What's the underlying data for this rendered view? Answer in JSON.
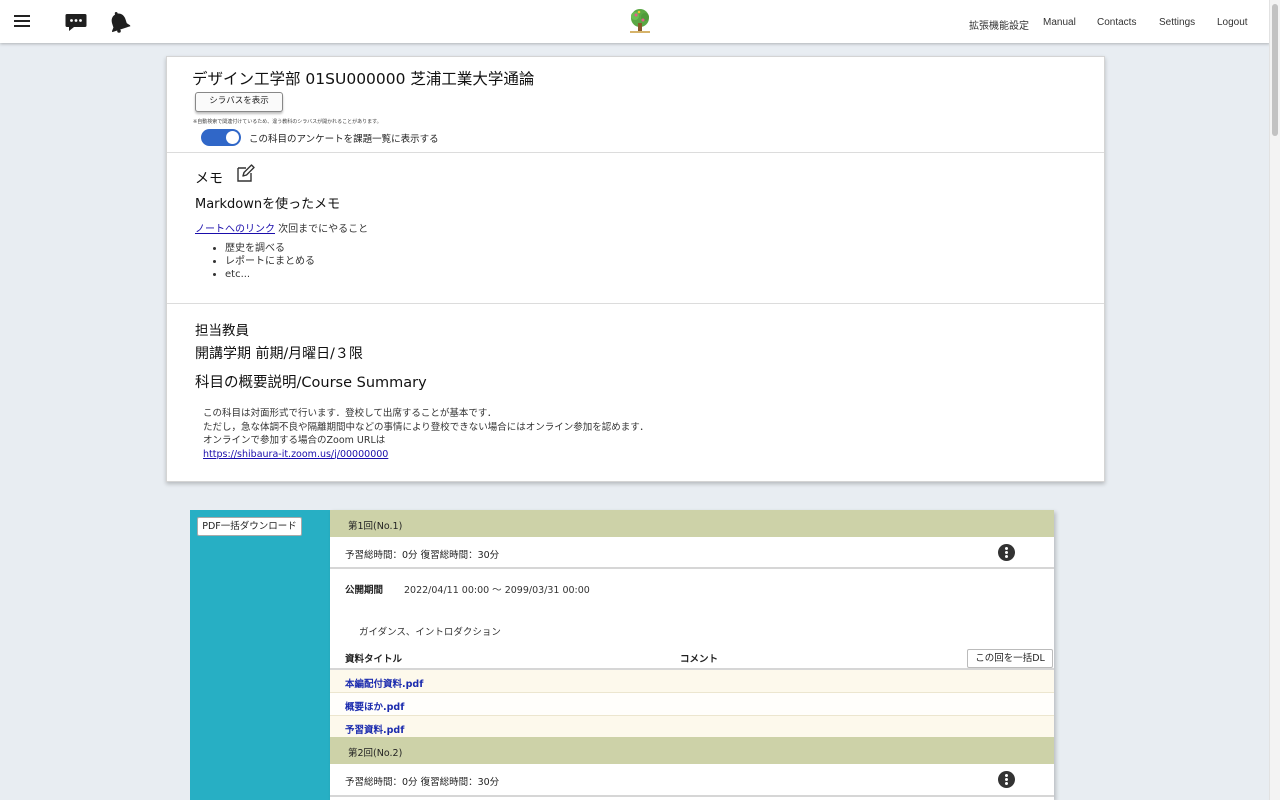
{
  "nav": {
    "links": [
      "拡張機能設定",
      "Manual",
      "Contacts",
      "Settings",
      "Logout"
    ]
  },
  "course": {
    "title": "デザイン工学部 01SU000000 芝浦工業大学通論",
    "syllabus_button": "シラバスを表示",
    "syllabus_note": "※自動検索で関連付けているため、違う教科のシラバスが開かれることがあります。",
    "survey_toggle_label": "この科目のアンケートを課題一覧に表示する",
    "survey_toggle_on": true
  },
  "memo": {
    "title": "メモ",
    "heading": "Markdownを使ったメモ",
    "link_text": "ノートへのリンク",
    "line_text": " 次回までにやること",
    "items": [
      "歴史を調べる",
      "レポートにまとめる",
      "etc..."
    ]
  },
  "info": {
    "teacher_heading": "担当教員",
    "term_heading": "開講学期 前期/月曜日/３限",
    "summary_heading": "科目の概要説明/Course Summary",
    "summary_lines": [
      "この科目は対面形式で行います．登校して出席することが基本です．",
      "ただし，急な体調不良や隔離期間中などの事情により登校できない場合にはオンライン参加を認めます．",
      "オンラインで参加する場合のZoom URLは"
    ],
    "zoom_url": "https://shibaura-it.zoom.us/j/00000000"
  },
  "materials": {
    "pdf_all_button": "PDF一括ダウンロード",
    "weeks": [
      {
        "title": "第1回(No.1)",
        "prep": "予習総時間：0分 復習総時間：30分",
        "pub_label": "公開期間",
        "pub_value": "2022/04/11 00:00 〜 2099/03/31 00:00",
        "intro": "ガイダンス、イントロダクション",
        "col_title": "資料タイトル",
        "col_comment": "コメント",
        "dl_button": "この回を一括DL",
        "files": [
          "本編配付資料.pdf",
          "概要ほか.pdf",
          "予習資料.pdf"
        ]
      },
      {
        "title": "第2回(No.2)",
        "prep": "予習総時間：0分 復習総時間：30分"
      }
    ]
  },
  "colors": {
    "accent_blue": "#3067c8",
    "sidebar_teal": "#27afc4",
    "week_header": "#cdd2a8",
    "link": "#1a0dab"
  }
}
